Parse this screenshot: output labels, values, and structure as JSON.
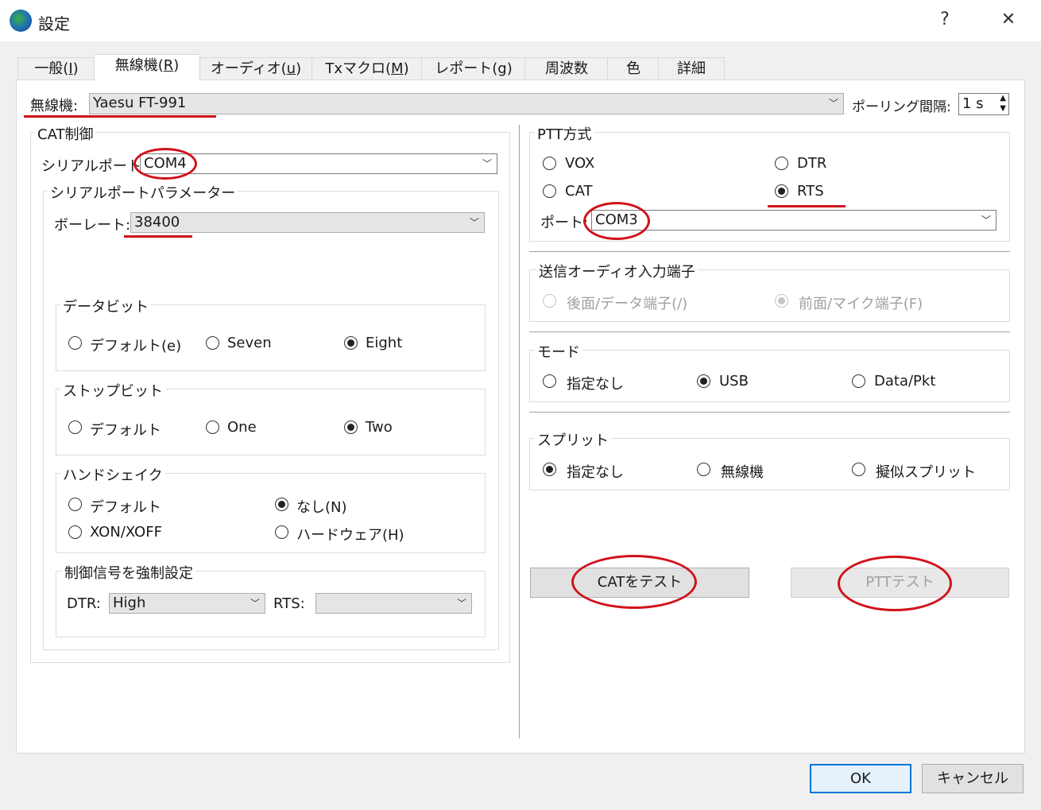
{
  "window": {
    "title": "設定",
    "help_label": "?",
    "close_label": "✕"
  },
  "tabs": [
    {
      "label": "一般(",
      "key": "I",
      "tail": ")"
    },
    {
      "label": "無線機(",
      "key": "R",
      "tail": ")"
    },
    {
      "label": "オーディオ(",
      "key": "u",
      "tail": ")"
    },
    {
      "label": "Txマクロ(",
      "key": "M",
      "tail": ")"
    },
    {
      "label": "レポート(",
      "key": "g",
      "tail": ")"
    },
    {
      "label": "周波数",
      "key": "",
      "tail": ""
    },
    {
      "label": "色",
      "key": "",
      "tail": ""
    },
    {
      "label": "詳細",
      "key": "",
      "tail": ""
    }
  ],
  "radio_row": {
    "label": "無線機:",
    "value": "Yaesu FT-991"
  },
  "polling": {
    "label": "ポーリング間隔:",
    "value": "1 s"
  },
  "cat": {
    "title": "CAT制御",
    "serial_port_label": "シリアルポート:",
    "serial_port_value": "COM4",
    "params_title": "シリアルポートパラメーター",
    "baud_label": "ボーレート:",
    "baud_value": "38400",
    "databits": {
      "title": "データビット",
      "opt1": "デフォルト(e)",
      "opt2": "Seven",
      "opt3": "Eight"
    },
    "stopbits": {
      "title": "ストップビット",
      "opt1": "デフォルト",
      "opt2": "One",
      "opt3": "Two"
    },
    "handshake": {
      "title": "ハンドシェイク",
      "opt1": "デフォルト",
      "opt2": "なし(N)",
      "opt3": "XON/XOFF",
      "opt4": "ハードウェア(H)"
    },
    "force": {
      "title": "制御信号を強制設定",
      "dtr_label": "DTR:",
      "dtr_value": "High",
      "rts_label": "RTS:",
      "rts_value": ""
    }
  },
  "ptt": {
    "title": "PTT方式",
    "opt_vox": "VOX",
    "opt_dtr": "DTR",
    "opt_cat": "CAT",
    "opt_rts": "RTS",
    "port_label": "ポート:",
    "port_value": "COM3"
  },
  "tx_audio": {
    "title": "送信オーディオ入力端子",
    "opt1": "後面/データ端子(/)",
    "opt2": "前面/マイク端子(F)"
  },
  "mode": {
    "title": "モード",
    "opt1": "指定なし",
    "opt2": "USB",
    "opt3": "Data/Pkt"
  },
  "split": {
    "title": "スプリット",
    "opt1": "指定なし",
    "opt2": "無線機",
    "opt3": "擬似スプリット"
  },
  "buttons": {
    "test_cat": "CATをテスト",
    "test_ptt": "PTTテスト",
    "ok": "OK",
    "cancel": "キャンセル"
  },
  "colors": {
    "accent": "#0078d7",
    "annotation": "#d0121b"
  }
}
